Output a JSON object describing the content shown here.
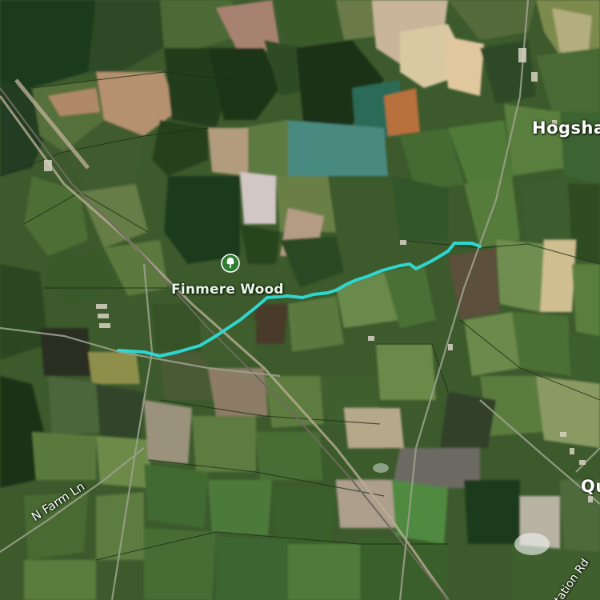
{
  "map": {
    "view": "satellite",
    "route_color": "#2fd6cf"
  },
  "poi": {
    "label": "Finmere Wood",
    "icon": "tree-icon",
    "icon_color": "#2e7d32"
  },
  "places": {
    "hogshaw": "Hogsha",
    "quainton": "Qu"
  },
  "roads": {
    "n_farm_ln": "N Farm Ln",
    "station_rd": "tation Rd"
  }
}
